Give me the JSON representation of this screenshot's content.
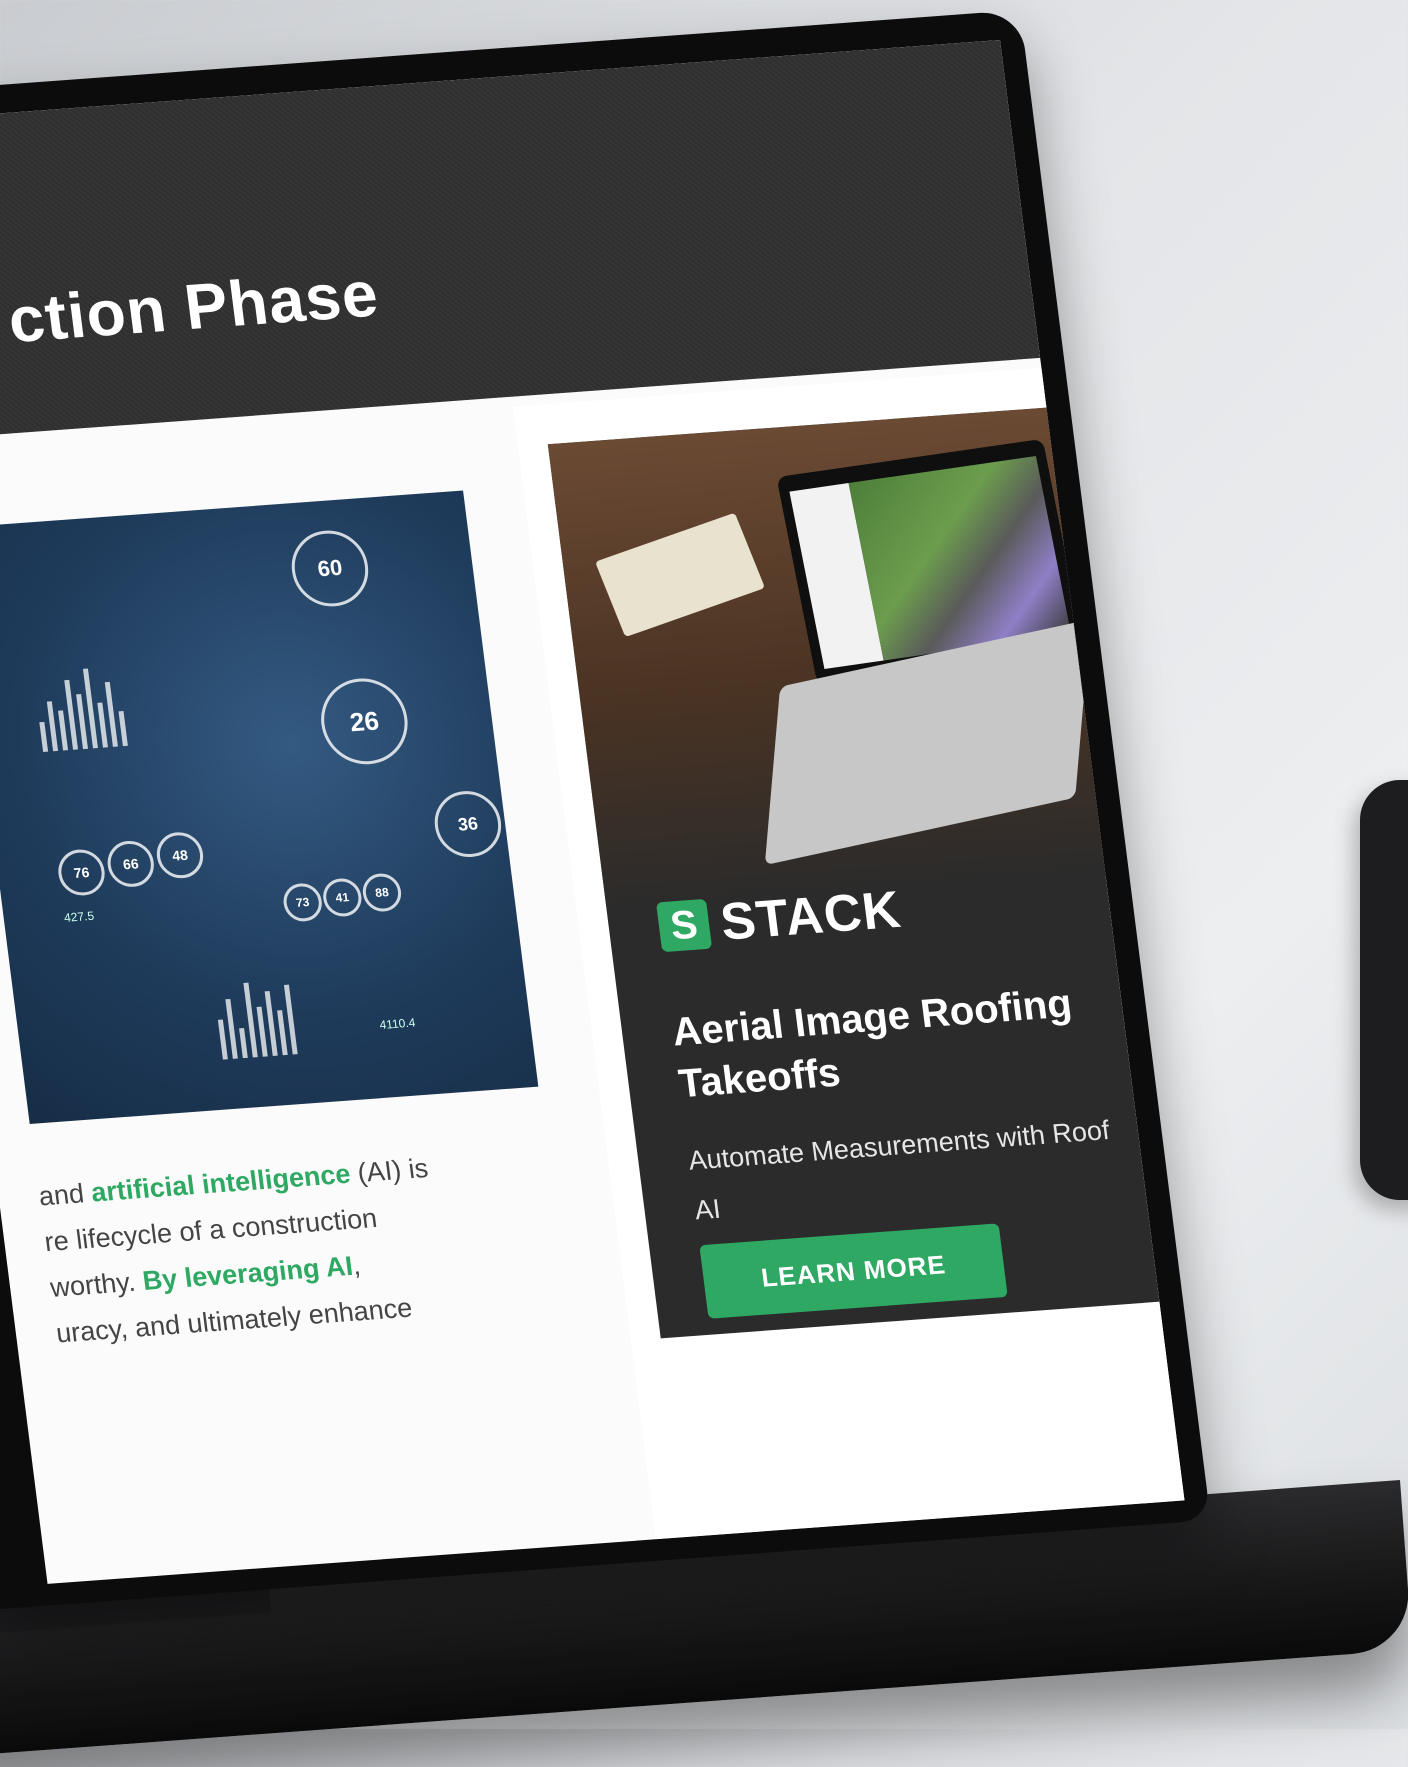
{
  "hero": {
    "title": "ction Phase"
  },
  "image_stats": {
    "gauge_1": "60",
    "gauge_2": "26",
    "gauge_3": "76",
    "gauge_4": "66",
    "gauge_5": "48",
    "gauge_6": "73",
    "gauge_7": "41",
    "gauge_8": "88",
    "gauge_9": "36",
    "small_value_1": "427.5",
    "small_value_2": "4110.4"
  },
  "article": {
    "line1_pre": "and ",
    "line1_link": "artificial intelligence",
    "line1_post": " (AI) is",
    "line2": "re lifecycle of a construction",
    "line3_pre": "worthy. ",
    "line3_link": "By leveraging AI",
    "line3_post": ",",
    "line4": "uracy, and ultimately enhance"
  },
  "ad": {
    "brand_mark": "S",
    "brand": "STACK",
    "headline": "Aerial Image Roofing Takeoffs",
    "subheading": "Automate Measurements with Roof AI",
    "button_label": "LEARN MORE"
  },
  "colors": {
    "accent_green": "#2ea862",
    "hero_bg": "#2f2f2f",
    "ad_bg": "#2b2b2b"
  }
}
